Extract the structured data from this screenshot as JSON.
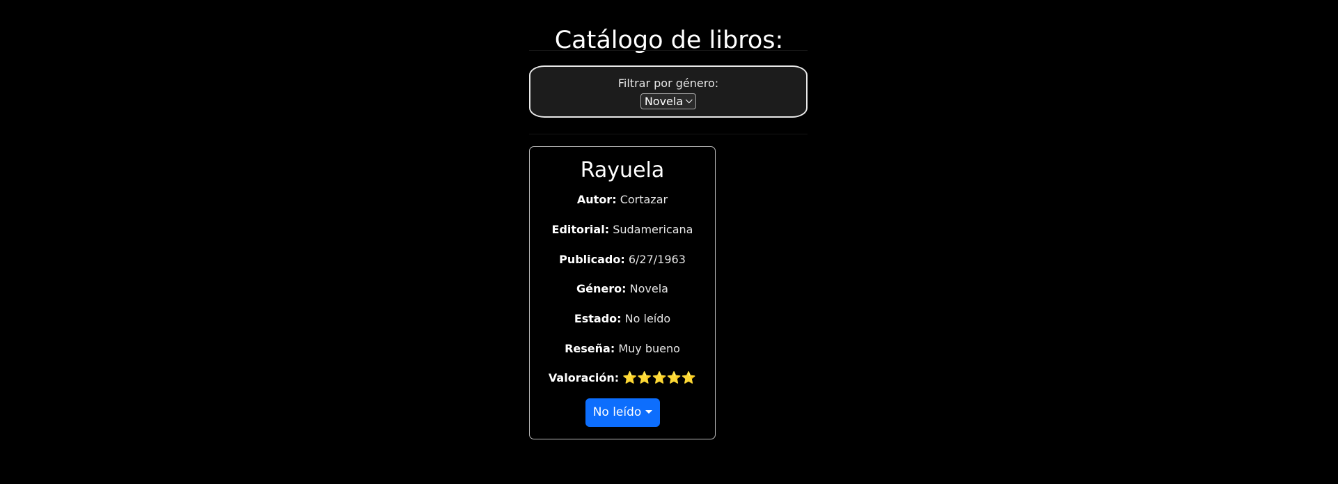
{
  "header": {
    "title": "Catálogo de libros:"
  },
  "filter": {
    "label": "Filtrar por género:",
    "selected": "Novela"
  },
  "book": {
    "title": "Rayuela",
    "fields": [
      {
        "label": "Autor:",
        "value": "Cortazar"
      },
      {
        "label": "Editorial:",
        "value": "Sudamericana"
      },
      {
        "label": "Publicado:",
        "value": "6/27/1963"
      },
      {
        "label": "Género:",
        "value": "Novela"
      },
      {
        "label": "Estado:",
        "value": "No leído"
      },
      {
        "label": "Reseña:",
        "value": "Muy bueno"
      }
    ],
    "rating_label": "Valoración:",
    "rating_stars": "⭐⭐⭐⭐⭐",
    "rating_value": 5,
    "status_button": "No leído"
  },
  "colors": {
    "background": "#000000",
    "accent_button": "#0d6efd",
    "star": "#f5c518"
  }
}
